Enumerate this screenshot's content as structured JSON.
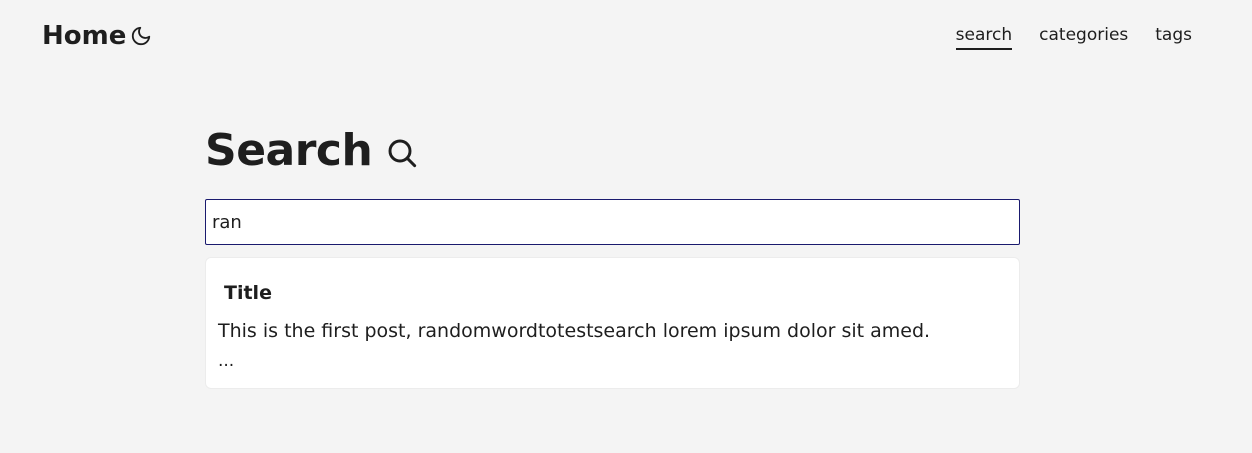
{
  "header": {
    "home_label": "Home",
    "theme_toggle_icon": "moon-icon",
    "nav": [
      {
        "label": "search",
        "active": true
      },
      {
        "label": "categories",
        "active": false
      },
      {
        "label": "tags",
        "active": false
      }
    ]
  },
  "search": {
    "title": "Search",
    "title_icon": "search-icon",
    "query": "ran",
    "results": [
      {
        "title": "Title",
        "excerpt": "This is the first post, randomwordtotestsearch lorem ipsum dolor sit amed.",
        "ellipsis": "..."
      }
    ]
  },
  "colors": {
    "background": "#f4f4f4",
    "text": "#1e1e1e",
    "input_border": "#1a1a6e",
    "card_background": "#ffffff"
  }
}
